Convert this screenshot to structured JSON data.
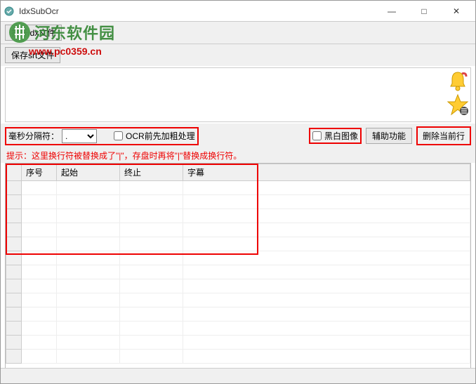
{
  "window": {
    "title": "IdxSubOcr",
    "minimize": "—",
    "maximize": "□",
    "close": "✕"
  },
  "watermark": {
    "site_name": "河东软件园",
    "url": "www.pc0359.cn"
  },
  "toolbar": {
    "open_idx": "打开idx文件",
    "save_srt": "保存srt文件"
  },
  "options": {
    "separator_label": "毫秒分隔符：",
    "separator_value": ".",
    "ocr_bold_label": "OCR前先加粗处理",
    "bw_image_label": "黑白图像",
    "aux_func": "辅助功能",
    "delete_row": "删除当前行"
  },
  "hint": "提示：这里换行符被替换成了\"|\"，存盘时再将\"|\"替换成换行符。",
  "grid": {
    "cols": {
      "seq": "序号",
      "start": "起始",
      "end": "终止",
      "sub": "字幕"
    },
    "rows": [
      "",
      "",
      "",
      "",
      "",
      "",
      "",
      "",
      "",
      "",
      "",
      "",
      ""
    ]
  }
}
